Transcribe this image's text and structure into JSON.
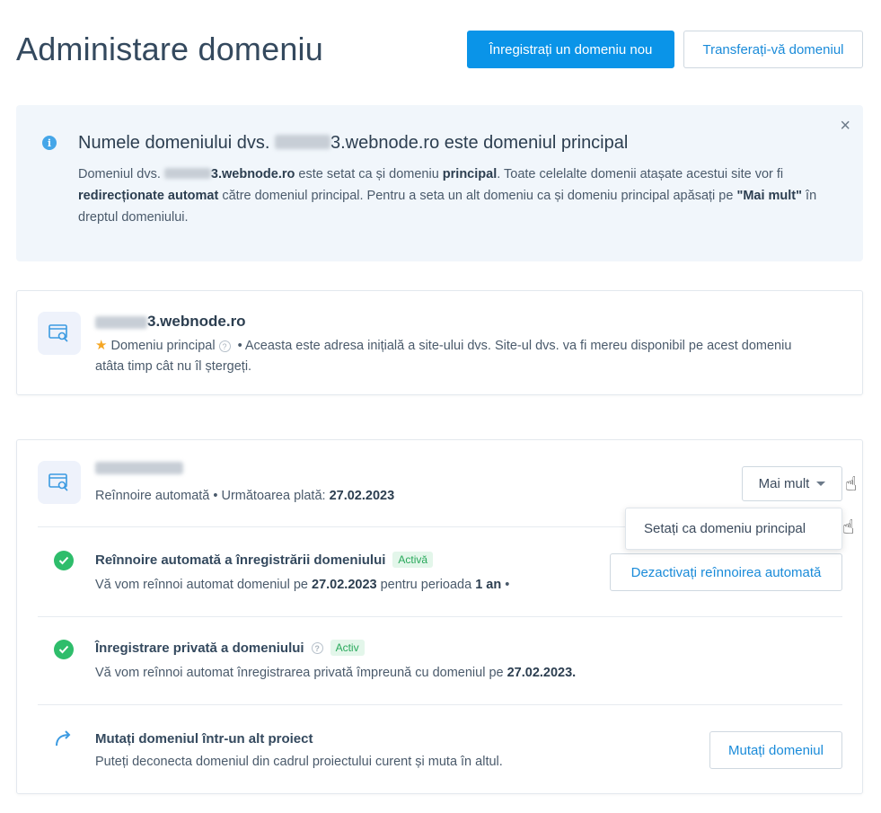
{
  "header": {
    "title": "Administare domeniu",
    "register_label": "Înregistrați un domeniu nou",
    "transfer_label": "Transferați-vă domeniul"
  },
  "info": {
    "title_prefix": "Numele domeniului dvs. ",
    "title_suffix": "3.webnode.ro este domeniul principal",
    "close": "×",
    "t1": "Domeniul dvs. ",
    "t2": "3.webnode.ro",
    "t3": " este setat ca și domeniu ",
    "t4": "principal",
    "t5": ". Toate celelalte domenii atașate acestui site vor fi ",
    "t6": "redirecționate automat",
    "t7": " către domeniul principal. Pentru a seta un alt domeniu ca și domeniu principal apăsați pe ",
    "t8": "\"Mai mult\"",
    "t9": " în dreptul domeniului."
  },
  "primary_domain": {
    "name_suffix": "3.webnode.ro",
    "status": "Domeniu principal",
    "help": "?",
    "desc": " • Aceasta este adresa inițială a site-ului dvs. Site-ul dvs. va fi mereu disponibil pe acest domeniu atâta timp cât nu îl ștergeți."
  },
  "second_domain": {
    "desc_prefix": "Reînnoire automată • Următoarea plată: ",
    "next_payment": "27.02.2023",
    "more_label": "Mai mult",
    "dropdown_item": "Setați ca domeniu principal",
    "renewal": {
      "title": "Reînnoire automată a înregistrării domeniului",
      "badge": "Activă",
      "d1": "Vă vom reînnoi automat domeniul pe ",
      "d2": "27.02.2023",
      "d3": " pentru perioada ",
      "d4": "1 an",
      "d5": " •",
      "button": "Dezactivați reînnoirea automată"
    },
    "privacy": {
      "title": "Înregistrare privată a domeniului",
      "help": "?",
      "badge": "Activ",
      "d1": "Vă vom reînnoi automat înregistrarea privată împreună cu domeniul pe ",
      "d2": "27.02.2023."
    },
    "move": {
      "title": "Mutați domeniul într-un alt proiect",
      "desc": "Puteți deconecta domeniul din cadrul proiectului curent și muta în altul.",
      "button": "Mutați domeniul"
    }
  }
}
